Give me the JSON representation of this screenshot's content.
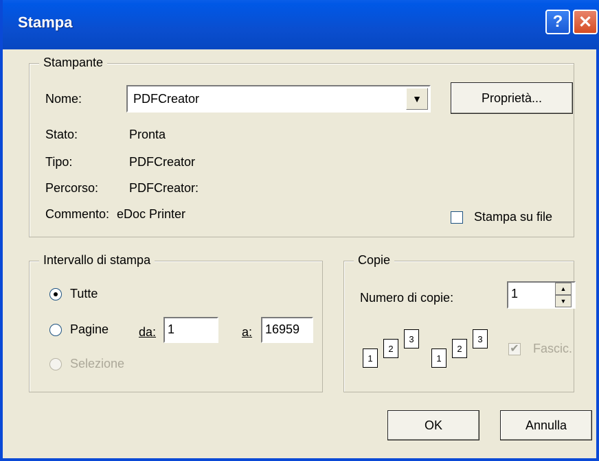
{
  "window": {
    "title": "Stampa",
    "help_glyph": "?",
    "close_glyph": "✕"
  },
  "printer": {
    "group_title": "Stampante",
    "name_label": "Nome:",
    "name_value": "PDFCreator",
    "properties_button": "Proprietà...",
    "status_label": "Stato:",
    "status_value": "Pronta",
    "type_label": "Tipo:",
    "type_value": "PDFCreator",
    "path_label": "Percorso:",
    "path_value": "PDFCreator:",
    "comment_label": "Commento:",
    "comment_value": "eDoc Printer",
    "print_to_file_label": "Stampa su file",
    "print_to_file_checked": false
  },
  "range": {
    "group_title": "Intervallo di stampa",
    "all_label": "Tutte",
    "all_selected": true,
    "pages_label": "Pagine",
    "from_label": "da:",
    "from_value": "1",
    "to_label": "a:",
    "to_value": "16959",
    "selection_label": "Selezione"
  },
  "copies": {
    "group_title": "Copie",
    "number_label": "Numero di copie:",
    "number_value": "1",
    "collate_label": "Fascic.",
    "collate_checked": true,
    "collate_check_glyph": "✔",
    "page_numbers": [
      "1",
      "2",
      "3"
    ]
  },
  "buttons": {
    "ok": "OK",
    "cancel": "Annulla"
  }
}
